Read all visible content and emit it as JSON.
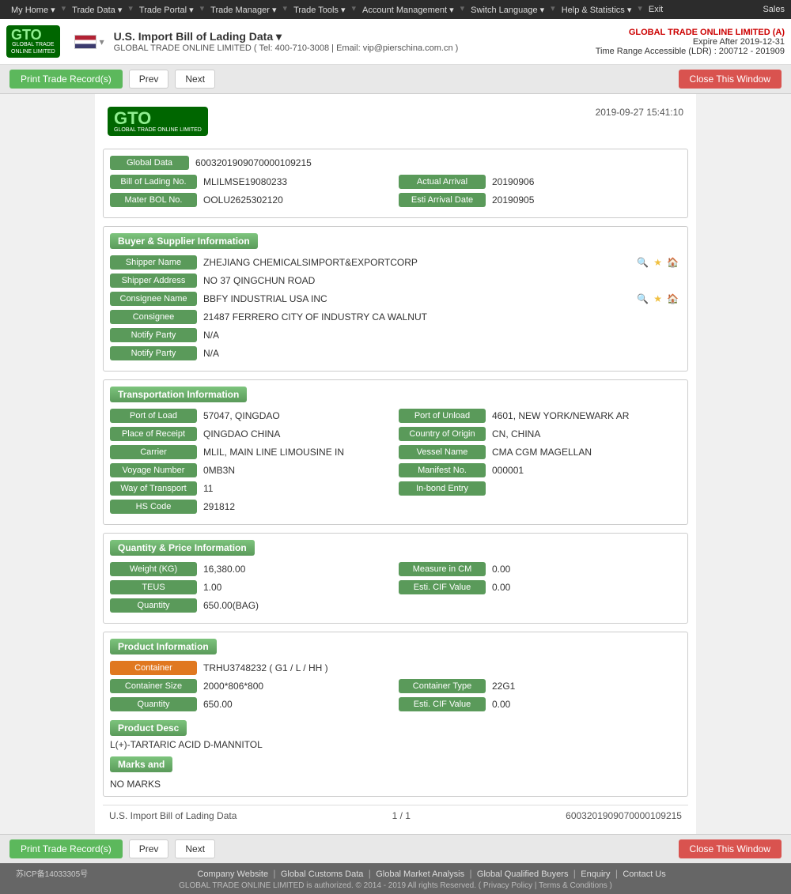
{
  "topnav": {
    "items": [
      "My Home",
      "Trade Data",
      "Trade Portal",
      "Trade Manager",
      "Trade Tools",
      "Account Management",
      "Switch Language",
      "Help & Statistics",
      "Exit"
    ],
    "sales": "Sales"
  },
  "header": {
    "logo_text": "GTO",
    "logo_sub": "GLOBAL TRADE ONLINE LIMITED",
    "title": "U.S. Import Bill of Lading Data",
    "contact": "GLOBAL TRADE ONLINE LIMITED ( Tel: 400-710-3008 | Email: vip@pierschina.com.cn )",
    "company": "GLOBAL TRADE ONLINE LIMITED (A)",
    "expire": "Expire After 2019-12-31",
    "time_range": "Time Range Accessible (LDR) : 200712 - 201909"
  },
  "toolbar": {
    "print_label": "Print Trade Record(s)",
    "prev_label": "Prev",
    "next_label": "Next",
    "close_label": "Close This Window"
  },
  "record": {
    "timestamp": "2019-09-27 15:41:10",
    "global_data_label": "Global Data",
    "global_data_value": "6003201909070000109215",
    "fields": {
      "bill_of_lading_no_label": "Bill of Lading No.",
      "bill_of_lading_no_value": "MLILMSE19080233",
      "actual_arrival_label": "Actual Arrival",
      "actual_arrival_value": "20190906",
      "mater_bol_no_label": "Mater BOL No.",
      "mater_bol_no_value": "OOLU2625302120",
      "esti_arrival_date_label": "Esti Arrival Date",
      "esti_arrival_date_value": "20190905"
    }
  },
  "buyer_supplier": {
    "section_title": "Buyer & Supplier Information",
    "shipper_name_label": "Shipper Name",
    "shipper_name_value": "ZHEJIANG CHEMICALSIMPORT&EXPORTCORP",
    "shipper_address_label": "Shipper Address",
    "shipper_address_value": "NO 37 QINGCHUN ROAD",
    "consignee_name_label": "Consignee Name",
    "consignee_name_value": "BBFY INDUSTRIAL USA INC",
    "consignee_label": "Consignee",
    "consignee_value": "21487 FERRERO CITY OF INDUSTRY CA WALNUT",
    "notify_party_label": "Notify Party",
    "notify_party_value1": "N/A",
    "notify_party_value2": "N/A"
  },
  "transportation": {
    "section_title": "Transportation Information",
    "port_of_load_label": "Port of Load",
    "port_of_load_value": "57047, QINGDAO",
    "port_of_unload_label": "Port of Unload",
    "port_of_unload_value": "4601, NEW YORK/NEWARK AR",
    "place_of_receipt_label": "Place of Receipt",
    "place_of_receipt_value": "QINGDAO CHINA",
    "country_of_origin_label": "Country of Origin",
    "country_of_origin_value": "CN, CHINA",
    "carrier_label": "Carrier",
    "carrier_value": "MLIL, MAIN LINE LIMOUSINE IN",
    "vessel_name_label": "Vessel Name",
    "vessel_name_value": "CMA CGM MAGELLAN",
    "voyage_number_label": "Voyage Number",
    "voyage_number_value": "0MB3N",
    "manifest_no_label": "Manifest No.",
    "manifest_no_value": "000001",
    "way_of_transport_label": "Way of Transport",
    "way_of_transport_value": "11",
    "in_bond_entry_label": "In-bond Entry",
    "in_bond_entry_value": "",
    "hs_code_label": "HS Code",
    "hs_code_value": "291812"
  },
  "quantity_price": {
    "section_title": "Quantity & Price Information",
    "weight_label": "Weight (KG)",
    "weight_value": "16,380.00",
    "measure_cm_label": "Measure in CM",
    "measure_cm_value": "0.00",
    "teus_label": "TEUS",
    "teus_value": "1.00",
    "esti_cif_label": "Esti. CIF Value",
    "esti_cif_value": "0.00",
    "quantity_label": "Quantity",
    "quantity_value": "650.00(BAG)"
  },
  "product_info": {
    "section_title": "Product Information",
    "container_label": "Container",
    "container_value": "TRHU3748232 ( G1 / L / HH )",
    "container_size_label": "Container Size",
    "container_size_value": "2000*806*800",
    "container_type_label": "Container Type",
    "container_type_value": "22G1",
    "quantity_label": "Quantity",
    "quantity_value": "650.00",
    "esti_cif_label": "Esti. CIF Value",
    "esti_cif_value": "0.00",
    "product_desc_label": "Product Desc",
    "product_desc_value": "L(+)-TARTARIC ACID D-MANNITOL",
    "marks_label": "Marks and",
    "marks_value": "NO MARKS"
  },
  "record_footer": {
    "left_text": "U.S. Import Bill of Lading Data",
    "page_info": "1 / 1",
    "right_text": "6003201909070000109215"
  },
  "footer": {
    "beian": "苏ICP备14033305号",
    "links": [
      "Company Website",
      "Global Customs Data",
      "Global Market Analysis",
      "Global Qualified Buyers",
      "Enquiry",
      "Contact Us"
    ],
    "copyright": "GLOBAL TRADE ONLINE LIMITED is authorized. © 2014 - 2019 All rights Reserved.  (  Privacy Policy  |  Terms & Conditions  )"
  }
}
